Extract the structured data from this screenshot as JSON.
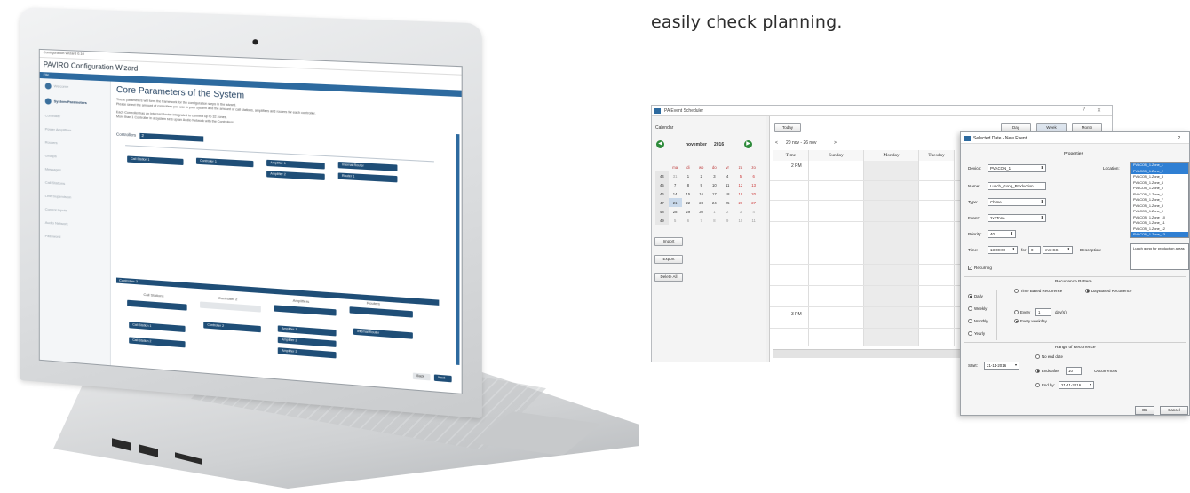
{
  "caption": "easily check planning.",
  "wizard": {
    "window_title": "Configuration Wizard 0.10",
    "app_title": "PAVIRO Configuration Wizard",
    "menu": "File",
    "sidebar": [
      {
        "label": "Welcome",
        "active": false
      },
      {
        "label": "System Parameters",
        "active": true
      },
      {
        "label": "Controller",
        "active": false
      },
      {
        "label": "Power Amplifiers",
        "active": false
      },
      {
        "label": "Routers",
        "active": false
      },
      {
        "label": "Groups",
        "active": false
      },
      {
        "label": "Messages",
        "active": false
      },
      {
        "label": "Call Stations",
        "active": false
      },
      {
        "label": "Line Supervision",
        "active": false
      },
      {
        "label": "Control Inputs",
        "active": false
      },
      {
        "label": "Audio Network",
        "active": false
      },
      {
        "label": "Password",
        "active": false
      }
    ],
    "heading": "Core Parameters of the System",
    "intro_1": "These parameters will form the framework for the configuration steps in the wizard.",
    "intro_2": "Please select the amount of controllers you use in your system and the amount of call stations, amplifiers and routers for each controller.",
    "intro_3": "Each Controller has an Internal Router integrated to connect up to 32 zones.",
    "intro_4": "More than 1 Controller in a system sets up an Audio Network with the Controllers.",
    "controllers_label": "Controllers",
    "controllers_value": "2",
    "block1": {
      "call_station": "Call Station 1",
      "controller": "Controller 1",
      "amplifier_1": "Amplifier 1",
      "amplifier_2": "Amplifier 2",
      "internal_router": "Internal Router",
      "router": "Router 1"
    },
    "block2": {
      "bar": "Controller 2",
      "col_call_stations": "Call Stations",
      "col_controller": "Controller 2",
      "col_amplifiers": "Amplifiers",
      "col_routers": "Routers",
      "call_station_1": "Call Station 1",
      "call_station_2": "Call Station 2",
      "controller": "Controller 2",
      "amplifier_1": "Amplifier 1",
      "amplifier_2": "Amplifier 2",
      "amplifier_3": "Amplifier 3",
      "internal_router": "Internal Router"
    },
    "back": "Back",
    "next": "Next"
  },
  "scheduler": {
    "title": "PA Event Scheduler",
    "calendar_label": "Calendar",
    "month": "november",
    "year": "2016",
    "weekday_headers": [
      "ma",
      "di",
      "wo",
      "do",
      "vr",
      "za",
      "zo"
    ],
    "weeks": [
      {
        "wk": "44",
        "days": [
          "31",
          "1",
          "2",
          "3",
          "4",
          "5",
          "6"
        ]
      },
      {
        "wk": "45",
        "days": [
          "7",
          "8",
          "9",
          "10",
          "11",
          "12",
          "13"
        ]
      },
      {
        "wk": "46",
        "days": [
          "14",
          "15",
          "16",
          "17",
          "18",
          "19",
          "20"
        ]
      },
      {
        "wk": "47",
        "days": [
          "21",
          "22",
          "23",
          "24",
          "25",
          "26",
          "27"
        ]
      },
      {
        "wk": "48",
        "days": [
          "28",
          "29",
          "30",
          "1",
          "2",
          "3",
          "4"
        ]
      },
      {
        "wk": "49",
        "days": [
          "5",
          "6",
          "7",
          "8",
          "9",
          "10",
          "11"
        ]
      }
    ],
    "import": "Import",
    "export": "Export",
    "delete_all": "Delete All",
    "today": "Today",
    "range_label": "20 nov - 26 nov",
    "view_day": "Day",
    "view_week": "Week",
    "view_month": "Month",
    "columns": [
      "Time",
      "Sunday",
      "Monday",
      "Tuesday"
    ],
    "time_2pm": "2 PM",
    "time_3pm": "3 PM"
  },
  "dialog": {
    "title": "Selected Date - New Event",
    "help": "?",
    "properties_header": "Properties",
    "device_label": "Device:",
    "device_value": "PVACON_1",
    "location_label": "Location:",
    "locations": [
      {
        "name": "PVACON_1.Zone_1",
        "selected": true
      },
      {
        "name": "PVACON_1.Zone_2",
        "selected": true
      },
      {
        "name": "PVACON_1.Zone_3",
        "selected": false
      },
      {
        "name": "PVACON_1.Zone_4",
        "selected": false
      },
      {
        "name": "PVACON_1.Zone_5",
        "selected": false
      },
      {
        "name": "PVACON_1.Zone_6",
        "selected": false
      },
      {
        "name": "PVACON_1.Zone_7",
        "selected": false
      },
      {
        "name": "PVACON_1.Zone_8",
        "selected": false
      },
      {
        "name": "PVACON_1.Zone_9",
        "selected": false
      },
      {
        "name": "PVACON_1.Zone_10",
        "selected": false
      },
      {
        "name": "PVACON_1.Zone_11",
        "selected": false
      },
      {
        "name": "PVACON_1.Zone_12",
        "selected": false
      },
      {
        "name": "PVACON_1.Zone_13",
        "selected": true
      }
    ],
    "name_label": "Name:",
    "name_value": "Lunch_Gong_Production",
    "type_label": "Type:",
    "type_value": "Chime",
    "event_label": "Event:",
    "event_value": "2x2Tone",
    "priority_label": "Priority:",
    "priority_value": "40",
    "time_label": "Time:",
    "time_value": "13:00:00",
    "for_label": "for",
    "for_value": "0",
    "unit_value": "mm:SS",
    "description_label": "Description:",
    "description_value": "Lunch gong for production areas",
    "recurring_label": "Recurring",
    "recurrence_header": "Recurrence Pattern",
    "daily": "Daily",
    "weekly": "Weekly",
    "monthly": "Monthly",
    "yearly": "Yearly",
    "time_based": "Time Based Recurrence",
    "day_based": "Day Based Recurrence",
    "every_label": "Every",
    "every_value": "1",
    "every_unit": "day(s)",
    "every_weekday": "Every weekday",
    "range_header": "Range of Recurrence",
    "start_label": "Start:",
    "start_value": "21-11-2016",
    "no_end": "No end date",
    "ends_after": "Ends after",
    "occ_value": "10",
    "occurrences": "Occurrences",
    "end_by": "End by:",
    "end_by_value": "21-11-2016",
    "ok": "OK",
    "cancel": "Cancel"
  }
}
